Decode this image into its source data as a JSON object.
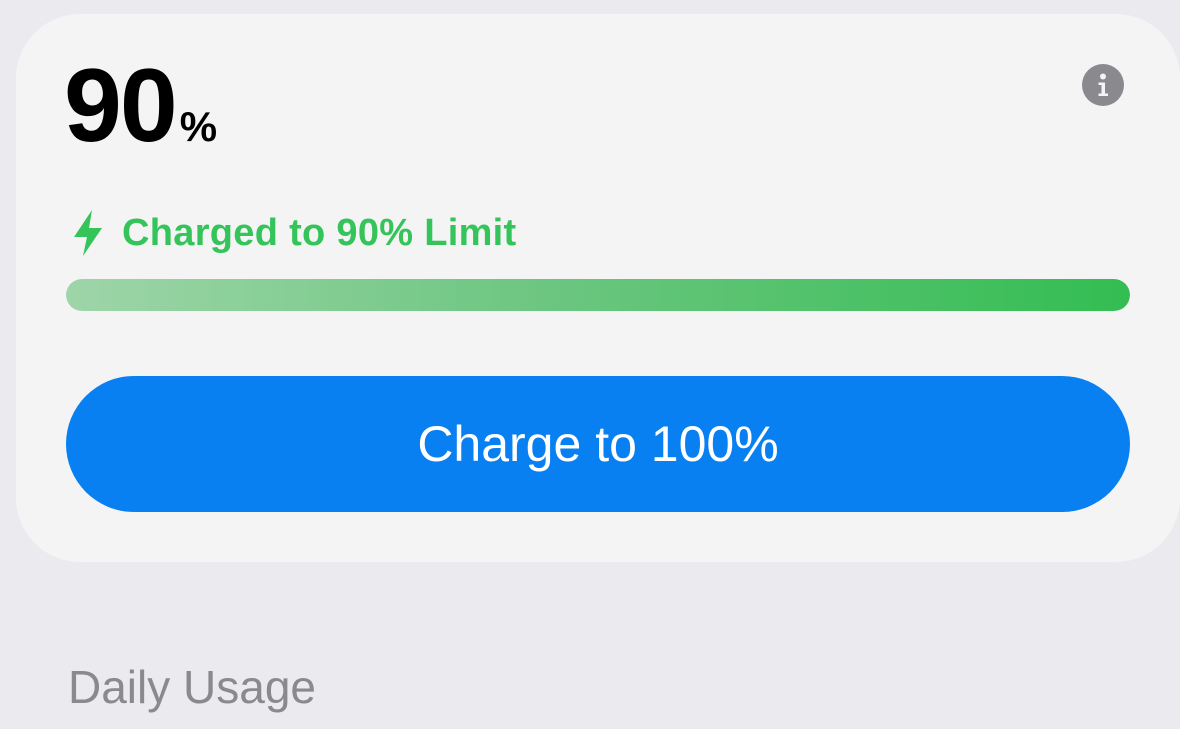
{
  "battery": {
    "level_number": "90",
    "level_unit": "%",
    "progress_fraction": 1.0,
    "status_text": "Charged to 90% Limit",
    "status_color": "#35c45a"
  },
  "actions": {
    "charge_button_label": "Charge to 100%",
    "button_color": "#0880f2"
  },
  "icons": {
    "info": "info-icon",
    "bolt": "lightning-bolt-icon"
  },
  "sections": {
    "daily_usage_title": "Daily Usage"
  }
}
